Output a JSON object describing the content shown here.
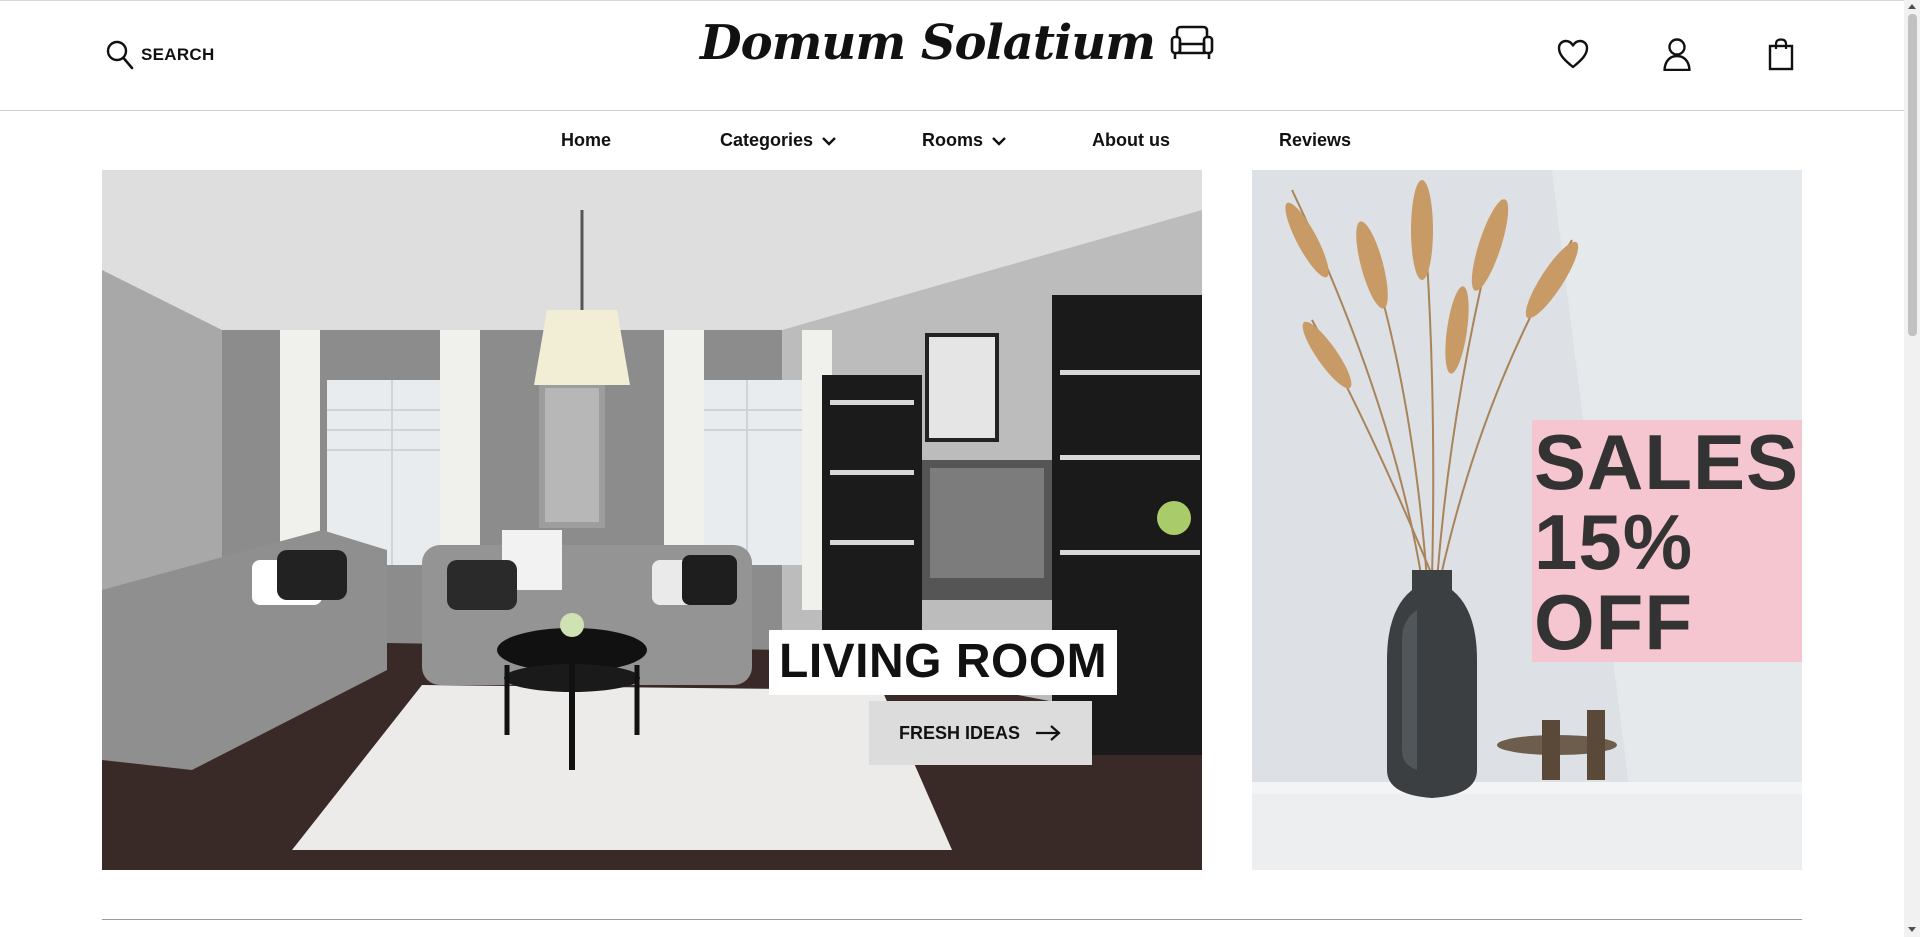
{
  "header": {
    "search_label": "SEARCH",
    "brand_name": "Domum Solatium",
    "icons": [
      "search-icon",
      "sofa-icon",
      "heart-icon",
      "user-icon",
      "shopping-bag-icon"
    ]
  },
  "nav": {
    "items": [
      {
        "label": "Home",
        "has_dropdown": false
      },
      {
        "label": "Categories",
        "has_dropdown": true
      },
      {
        "label": "Rooms",
        "has_dropdown": true
      },
      {
        "label": "About us",
        "has_dropdown": false
      },
      {
        "label": "Reviews",
        "has_dropdown": false
      }
    ]
  },
  "hero": {
    "label": "LIVING ROOM",
    "cta_label": "FRESH IDEAS"
  },
  "promo": {
    "lines": [
      "SALES",
      "15%",
      "OFF"
    ]
  },
  "colors": {
    "promo_bg": "#f6c6d0",
    "cta_bg": "#dcdcdc",
    "text": "#111111"
  }
}
